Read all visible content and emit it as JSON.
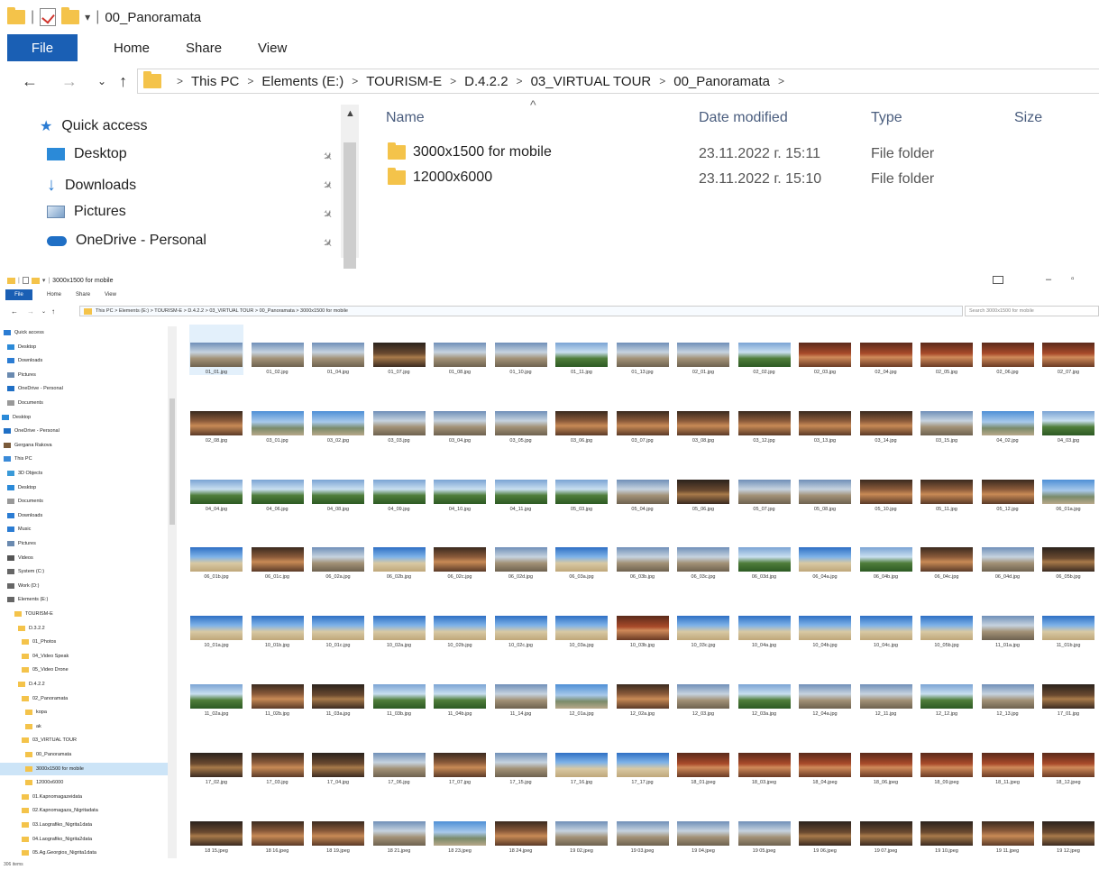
{
  "top_window": {
    "title": "00_Panoramata",
    "ribbon_tabs": [
      "File",
      "Home",
      "Share",
      "View"
    ],
    "breadcrumb": [
      "This PC",
      "Elements (E:)",
      "TOURISM-E",
      "D.4.2.2",
      "03_VIRTUAL TOUR",
      "00_Panoramata"
    ],
    "quick_access": "Quick access",
    "sidebar": [
      "Desktop",
      "Downloads",
      "Pictures",
      "OneDrive - Personal"
    ],
    "columns": [
      "Name",
      "Date modified",
      "Type",
      "Size"
    ],
    "rows": [
      {
        "name": "3000x1500 for mobile",
        "date": "23.11.2022 г. 15:11",
        "type": "File folder"
      },
      {
        "name": "12000x6000",
        "date": "23.11.2022 г. 15:10",
        "type": "File folder"
      }
    ]
  },
  "bottom_window": {
    "title": "3000x1500 for mobile",
    "ribbon_tabs": [
      "File",
      "Home",
      "Share",
      "View"
    ],
    "address": "This PC  >  Elements (E:)  >  TOURISM-E  >  D.4.2.2  >  03_VIRTUAL TOUR  >  00_Panoramata  >  3000x1500 for mobile",
    "search_placeholder": "Search 3000x1500 for mobile",
    "status": "306 items",
    "tree": [
      "Quick access",
      "Desktop",
      "Downloads",
      "Pictures",
      "OneDrive - Personal",
      "Documents",
      "Desktop",
      "OneDrive - Personal",
      "Gergana Rakova",
      "This PC",
      "3D Objects",
      "Desktop",
      "Documents",
      "Downloads",
      "Music",
      "Pictures",
      "Videos",
      "System (C:)",
      "Work (D:)",
      "Elements (E:)",
      "TOURISM-E",
      "D.3.2.2",
      "01_Photos",
      "04_Video Speak",
      "05_Video Drone",
      "D.4.2.2",
      "02_Panoramata",
      "kopa",
      "ak",
      "03_VIRTUAL TOUR",
      "00_Panoramata",
      "3000x1500 for mobile",
      "12000x6000",
      "01.Kapnomagazeidata",
      "02.Kapnomagaza_Nigritadata",
      "03.Laografiko_Nigrita1data",
      "04.Laografiko_Nigrita2data",
      "05.Ag.Georgios_Nigrita1data"
    ],
    "files": [
      "01_01.jpg",
      "01_02.jpg",
      "01_04.jpg",
      "01_07.jpg",
      "01_08.jpg",
      "01_10.jpg",
      "01_11.jpg",
      "01_13.jpg",
      "02_01.jpg",
      "02_02.jpg",
      "02_03.jpg",
      "02_04.jpg",
      "02_05.jpg",
      "02_06.jpg",
      "02_07.jpg",
      "02_08.jpg",
      "03_01.jpg",
      "03_02.jpg",
      "03_03.jpg",
      "03_04.jpg",
      "03_05.jpg",
      "03_06.jpg",
      "03_07.jpg",
      "03_08.jpg",
      "03_12.jpg",
      "03_13.jpg",
      "03_14.jpg",
      "03_15.jpg",
      "04_02.jpg",
      "04_03.jpg",
      "04_04.jpg",
      "04_06.jpg",
      "04_08.jpg",
      "04_09.jpg",
      "04_10.jpg",
      "04_11.jpg",
      "05_03.jpg",
      "05_04.jpg",
      "05_06.jpg",
      "05_07.jpg",
      "05_08.jpg",
      "05_10.jpg",
      "05_11.jpg",
      "05_12.jpg",
      "06_01a.jpg",
      "06_01b.jpg",
      "06_01c.jpg",
      "06_02a.jpg",
      "06_02b.jpg",
      "06_02c.jpg",
      "06_02d.jpg",
      "06_03a.jpg",
      "06_03b.jpg",
      "06_03c.jpg",
      "06_03d.jpg",
      "06_04a.jpg",
      "06_04b.jpg",
      "06_04c.jpg",
      "06_04d.jpg",
      "06_05b.jpg",
      "10_01a.jpg",
      "10_01b.jpg",
      "10_01c.jpg",
      "10_02a.jpg",
      "10_02b.jpg",
      "10_02c.jpg",
      "10_03a.jpg",
      "10_03b.jpg",
      "10_03c.jpg",
      "10_04a.jpg",
      "10_04b.jpg",
      "10_04c.jpg",
      "10_05b.jpg",
      "11_01a.jpg",
      "11_01b.jpg",
      "11_02a.jpg",
      "11_02b.jpg",
      "11_03a.jpg",
      "11_03b.jpg",
      "11_04b.jpg",
      "11_14.jpg",
      "12_01a.jpg",
      "12_02a.jpg",
      "12_03.jpg",
      "12_03a.jpg",
      "12_04a.jpg",
      "12_11.jpg",
      "12_12.jpg",
      "12_13.jpg",
      "17_01.jpg",
      "17_02.jpg",
      "17_03.jpg",
      "17_04.jpg",
      "17_06.jpg",
      "17_07.jpg",
      "17_15.jpg",
      "17_16.jpg",
      "17_17.jpg",
      "18_01.jpeg",
      "18_03.jpeg",
      "18_04.jpeg",
      "18_06.jpeg",
      "18_09.jpeg",
      "18_11.jpeg",
      "18_12.jpeg",
      "18 15.jpeg",
      "18 16.jpeg",
      "18 19.jpeg",
      "18 21.jpeg",
      "18 23.jpeg",
      "18 24.jpeg",
      "19 02.jpeg",
      "19 03.jpeg",
      "19 04.jpeg",
      "19 05.jpeg",
      "19 06.jpeg",
      "19 07.jpeg",
      "19 10.jpeg",
      "19 11.jpeg",
      "19 12.jpeg"
    ]
  }
}
